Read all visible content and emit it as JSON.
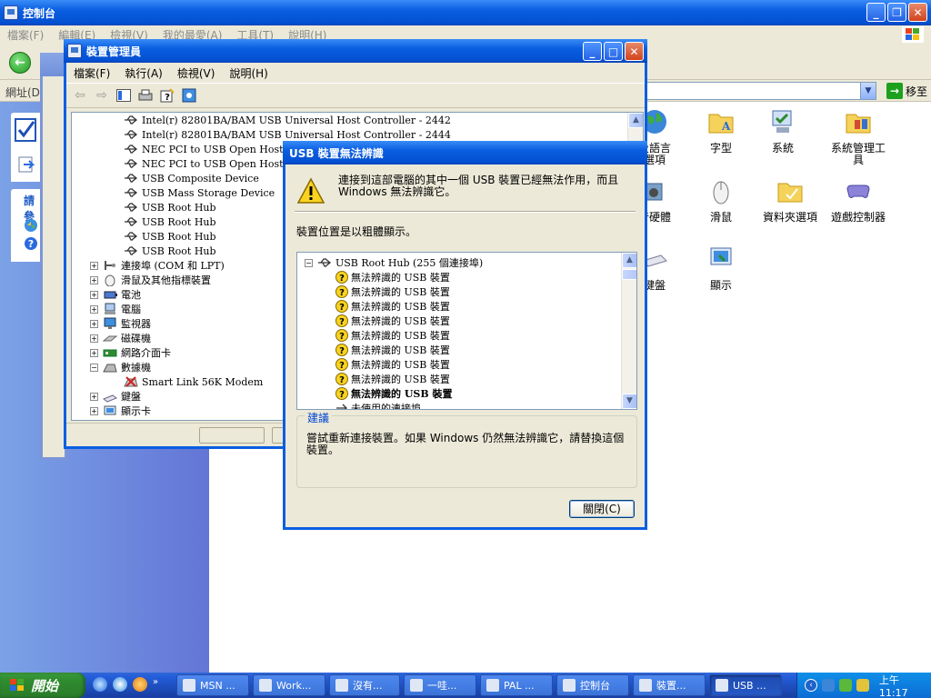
{
  "control_panel": {
    "title": "控制台",
    "menu": [
      "檔案(F)",
      "編輯(E)",
      "檢視(V)",
      "我的最愛(A)",
      "工具(T)",
      "說明(H)"
    ],
    "address_label": "網址(D)",
    "go_label": "移至",
    "side_label": "請參",
    "items": [
      {
        "label": "及語言\n選項",
        "icon": "globe-icon"
      },
      {
        "label": "字型",
        "icon": "font-folder-icon"
      },
      {
        "label": "系統",
        "icon": "system-icon"
      },
      {
        "label": "系統管理工\n具",
        "icon": "admin-tools-icon"
      },
      {
        "label": "音硬體",
        "icon": "sound-icon"
      },
      {
        "label": "滑鼠",
        "icon": "mouse-icon"
      },
      {
        "label": "資料夾選項",
        "icon": "folder-options-icon"
      },
      {
        "label": "遊戲控制器",
        "icon": "gamepad-icon"
      },
      {
        "label": "鍵盤",
        "icon": "keyboard-icon"
      },
      {
        "label": "顯示",
        "icon": "display-icon"
      }
    ]
  },
  "device_manager": {
    "title": "裝置管理員",
    "menu": [
      "檔案(F)",
      "執行(A)",
      "檢視(V)",
      "說明(H)"
    ],
    "tree": [
      {
        "label": "Intel(r) 82801BA/BAM USB Universal Host Controller - 2442",
        "level": 2,
        "icon": "usb-icon"
      },
      {
        "label": "Intel(r) 82801BA/BAM USB Universal Host Controller - 2444",
        "level": 2,
        "icon": "usb-icon"
      },
      {
        "label": "NEC PCI to USB Open Host Con",
        "level": 2,
        "icon": "usb-icon"
      },
      {
        "label": "NEC PCI to USB Open Host Con",
        "level": 2,
        "icon": "usb-icon"
      },
      {
        "label": "USB Composite Device",
        "level": 2,
        "icon": "usb-icon"
      },
      {
        "label": "USB Mass Storage Device",
        "level": 2,
        "icon": "usb-icon"
      },
      {
        "label": "USB Root Hub",
        "level": 2,
        "icon": "usb-icon"
      },
      {
        "label": "USB Root Hub",
        "level": 2,
        "icon": "usb-icon"
      },
      {
        "label": "USB Root Hub",
        "level": 2,
        "icon": "usb-icon"
      },
      {
        "label": "USB Root Hub",
        "level": 2,
        "icon": "usb-icon"
      },
      {
        "label": "連接埠 (COM 和 LPT)",
        "level": 1,
        "icon": "port-icon",
        "expander": "+"
      },
      {
        "label": "滑鼠及其他指標裝置",
        "level": 1,
        "icon": "mouse-icon",
        "expander": "+"
      },
      {
        "label": "電池",
        "level": 1,
        "icon": "battery-icon",
        "expander": "+"
      },
      {
        "label": "電腦",
        "level": 1,
        "icon": "computer-icon",
        "expander": "+"
      },
      {
        "label": "監視器",
        "level": 1,
        "icon": "monitor-icon",
        "expander": "+"
      },
      {
        "label": "磁碟機",
        "level": 1,
        "icon": "disk-icon",
        "expander": "+"
      },
      {
        "label": "網路介面卡",
        "level": 1,
        "icon": "network-card-icon",
        "expander": "+"
      },
      {
        "label": "數據機",
        "level": 1,
        "icon": "modem-icon",
        "expander": "−"
      },
      {
        "label": "Smart Link 56K Modem",
        "level": 2,
        "icon": "modem-disabled-icon"
      },
      {
        "label": "鍵盤",
        "level": 1,
        "icon": "keyboard-icon",
        "expander": "+"
      },
      {
        "label": "顯示卡",
        "level": 1,
        "icon": "display-adapter-icon",
        "expander": "+"
      }
    ]
  },
  "usb_dialog": {
    "title": "USB 裝置無法辨識",
    "message": "連接到這部電腦的其中一個 USB 裝置已經無法作用，而且 Windows 無法辨識它。",
    "location_label": "裝置位置是以粗體顯示。",
    "root_label": "USB Root Hub (255 個連接埠)",
    "devices": [
      {
        "label": "無法辨識的 USB 裝置",
        "bold": false
      },
      {
        "label": "無法辨識的 USB 裝置",
        "bold": false
      },
      {
        "label": "無法辨識的 USB 裝置",
        "bold": false
      },
      {
        "label": "無法辨識的 USB 裝置",
        "bold": false
      },
      {
        "label": "無法辨識的 USB 裝置",
        "bold": false
      },
      {
        "label": "無法辨識的 USB 裝置",
        "bold": false
      },
      {
        "label": "無法辨識的 USB 裝置",
        "bold": false
      },
      {
        "label": "無法辨識的 USB 裝置",
        "bold": false
      },
      {
        "label": "無法辨識的 USB 裝置",
        "bold": true
      },
      {
        "label": "未使用的連接埠",
        "bold": false
      }
    ],
    "advice_title": "建議",
    "advice_text": "嘗試重新連接裝置。如果 Windows 仍然無法辨識它，請替換這個裝置。",
    "close_label": "關閉(C)"
  },
  "taskbar": {
    "start_label": "開始",
    "tasks": [
      {
        "label": "MSN ...",
        "active": false
      },
      {
        "label": "Work...",
        "active": false
      },
      {
        "label": "沒有...",
        "active": false
      },
      {
        "label": "一哇...",
        "active": false
      },
      {
        "label": "PAL ...",
        "active": false
      },
      {
        "label": "控制台",
        "active": false
      },
      {
        "label": "裝置...",
        "active": false
      },
      {
        "label": "USB ...",
        "active": true
      }
    ],
    "clock": "上午 11:17"
  }
}
